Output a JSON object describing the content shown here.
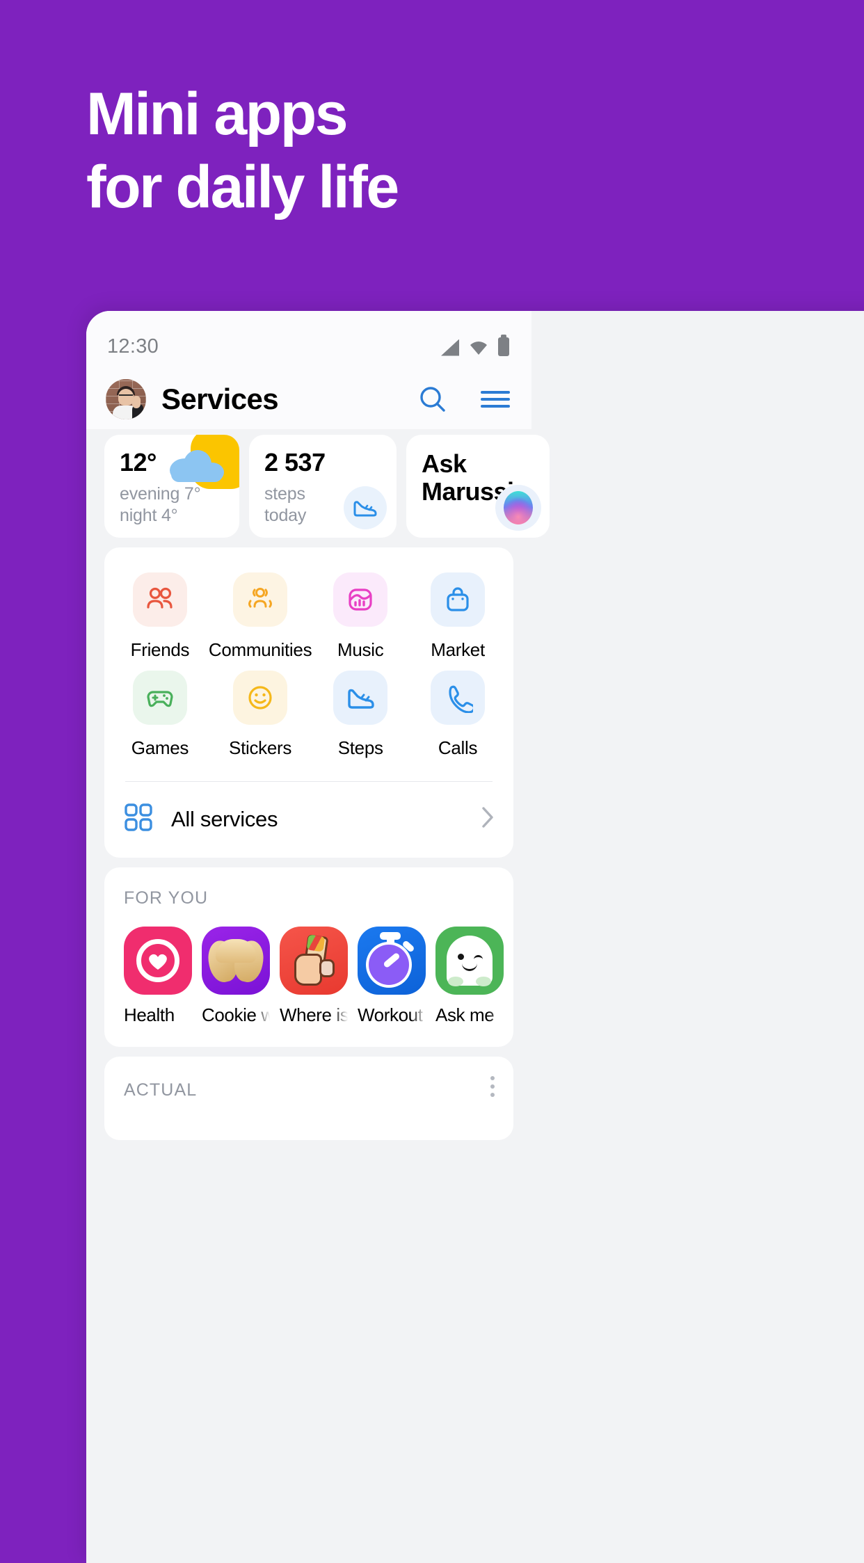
{
  "promo": {
    "line1": "Mini apps",
    "line2": "for daily life",
    "background_color": "#7E22BE",
    "text_color": "#FFFFFF"
  },
  "statusbar": {
    "time": "12:30",
    "icons": [
      "signal-icon",
      "wifi-icon",
      "battery-icon"
    ]
  },
  "appbar": {
    "title": "Services",
    "avatar_alt": "user-avatar",
    "search_icon": "search-icon",
    "menu_icon": "hamburger-menu-icon",
    "accent_color": "#2B7BD4"
  },
  "widgets": {
    "weather": {
      "temperature": "12°",
      "evening": "evening 7°",
      "night": "night 4°",
      "icon": "sun-behind-cloud-icon",
      "sun_color": "#FBC500",
      "cloud_color": "#8CC5F2"
    },
    "steps": {
      "count": "2 537",
      "label_line1": "steps",
      "label_line2": "today",
      "badge_icon": "sneaker-icon"
    },
    "assistant": {
      "line1": "Ask",
      "line2": "Marussia",
      "orb_icon": "assistant-orb-icon"
    }
  },
  "services": {
    "tiles": [
      {
        "label": "Friends",
        "icon": "friends-icon",
        "fg": "#E8563E",
        "bg": "#FCEDE9"
      },
      {
        "label": "Communities",
        "icon": "communities-icon",
        "fg": "#F5A623",
        "bg": "#FDF4E3"
      },
      {
        "label": "Music",
        "icon": "music-icon",
        "fg": "#E83FC4",
        "bg": "#FBEAFB"
      },
      {
        "label": "Market",
        "icon": "market-bag-icon",
        "fg": "#2B8FE8",
        "bg": "#E8F1FC"
      },
      {
        "label": "Games",
        "icon": "gamepad-icon",
        "fg": "#49B05B",
        "bg": "#EAF6EC"
      },
      {
        "label": "Stickers",
        "icon": "smiley-icon",
        "fg": "#F5B81A",
        "bg": "#FDF4E0"
      },
      {
        "label": "Steps",
        "icon": "sneaker-icon",
        "fg": "#2B8FE8",
        "bg": "#E8F1FC"
      },
      {
        "label": "Calls",
        "icon": "phone-icon",
        "fg": "#2B8FE8",
        "bg": "#E8F1FC"
      }
    ],
    "all_services": {
      "label": "All services",
      "icon": "grid-squares-icon",
      "chevron": "chevron-right-icon"
    }
  },
  "for_you": {
    "title": "FOR YOU",
    "apps": [
      {
        "label": "Health",
        "icon": "health-heart-icon",
        "bg": "#F02D6E"
      },
      {
        "label": "Cookie with",
        "icon": "fortune-cookie-icon",
        "bg": "#8B1FE0"
      },
      {
        "label": "Where is the",
        "icon": "shawarma-hand-icon",
        "bg": "#F0463C"
      },
      {
        "label": "Workout",
        "icon": "stopwatch-icon",
        "bg": "#1470E8"
      },
      {
        "label": "Ask me",
        "icon": "ghost-icon",
        "bg": "#4CB557"
      }
    ]
  },
  "actual": {
    "title": "ACTUAL",
    "menu_icon": "more-vertical-icon"
  }
}
